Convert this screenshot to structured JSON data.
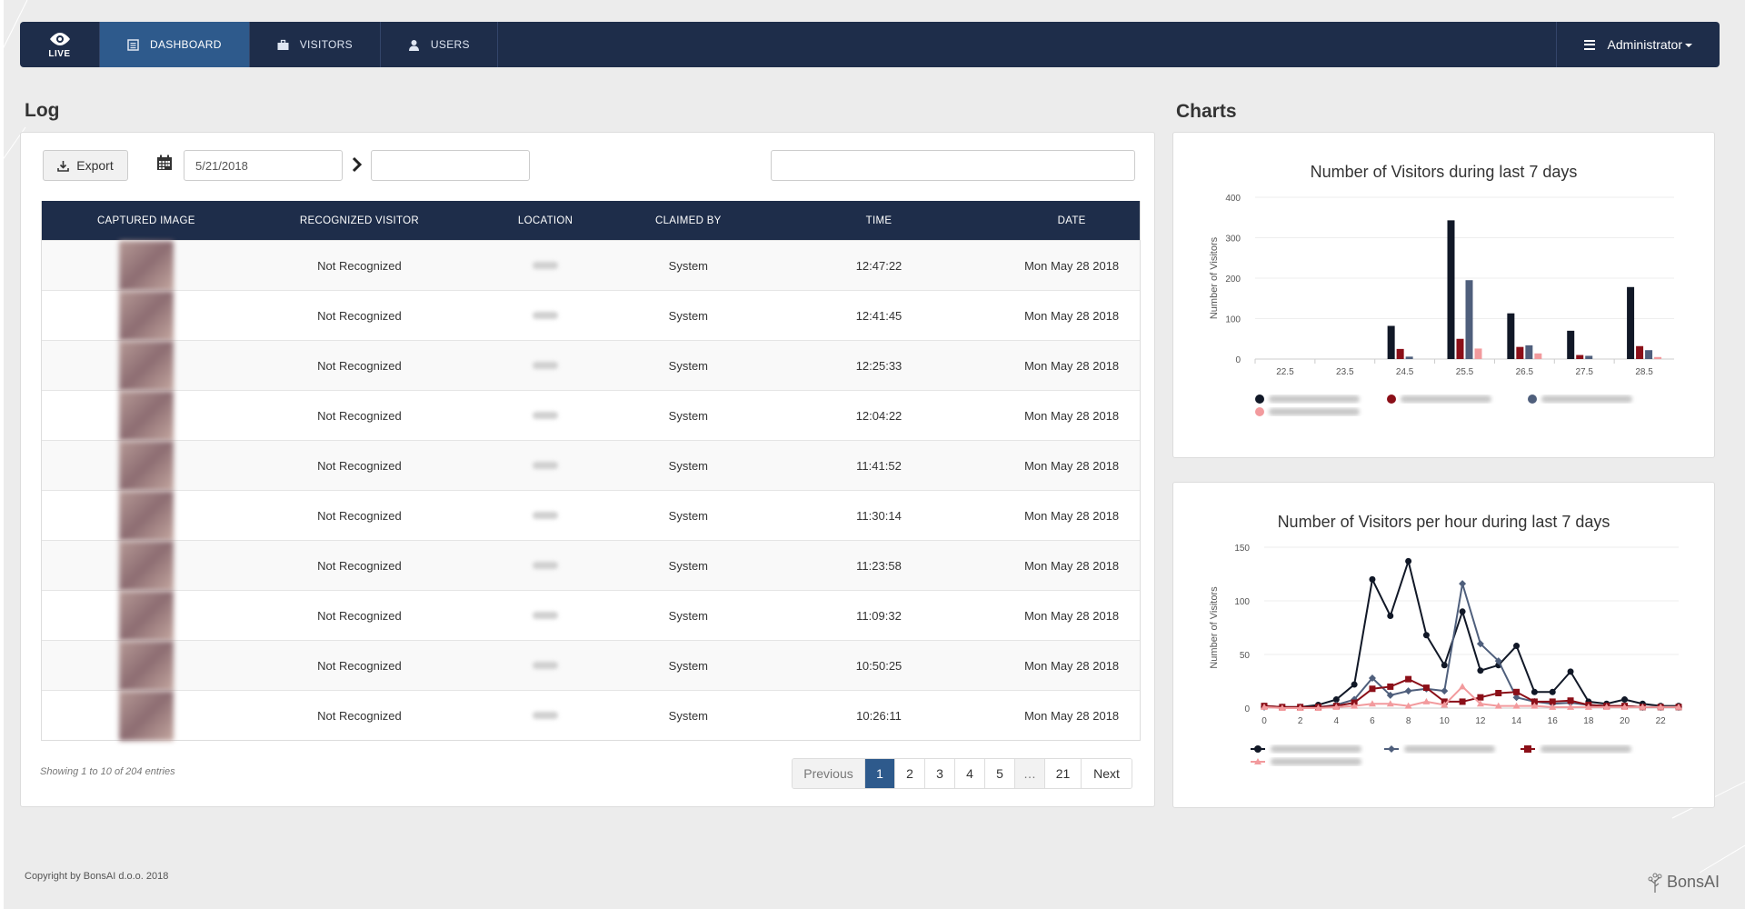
{
  "nav": {
    "brand": "LIVE",
    "items": [
      {
        "label": "DASHBOARD",
        "icon": "document-icon",
        "active": true
      },
      {
        "label": "VISITORS",
        "icon": "briefcase-icon",
        "active": false
      },
      {
        "label": "USERS",
        "icon": "user-icon",
        "active": false
      }
    ],
    "user": "Administrator"
  },
  "log": {
    "title": "Log",
    "export_label": "Export",
    "date_from": "5/21/2018",
    "date_to": "",
    "search": "",
    "columns": [
      "CAPTURED IMAGE",
      "RECOGNIZED VISITOR",
      "LOCATION",
      "CLAIMED BY",
      "TIME",
      "DATE"
    ],
    "rows": [
      {
        "visitor": "Not Recognized",
        "claimed": "System",
        "time": "12:47:22",
        "date": "Mon May 28 2018"
      },
      {
        "visitor": "Not Recognized",
        "claimed": "System",
        "time": "12:41:45",
        "date": "Mon May 28 2018"
      },
      {
        "visitor": "Not Recognized",
        "claimed": "System",
        "time": "12:25:33",
        "date": "Mon May 28 2018"
      },
      {
        "visitor": "Not Recognized",
        "claimed": "System",
        "time": "12:04:22",
        "date": "Mon May 28 2018"
      },
      {
        "visitor": "Not Recognized",
        "claimed": "System",
        "time": "11:41:52",
        "date": "Mon May 28 2018"
      },
      {
        "visitor": "Not Recognized",
        "claimed": "System",
        "time": "11:30:14",
        "date": "Mon May 28 2018"
      },
      {
        "visitor": "Not Recognized",
        "claimed": "System",
        "time": "11:23:58",
        "date": "Mon May 28 2018"
      },
      {
        "visitor": "Not Recognized",
        "claimed": "System",
        "time": "11:09:32",
        "date": "Mon May 28 2018"
      },
      {
        "visitor": "Not Recognized",
        "claimed": "System",
        "time": "10:50:25",
        "date": "Mon May 28 2018"
      },
      {
        "visitor": "Not Recognized",
        "claimed": "System",
        "time": "10:26:11",
        "date": "Mon May 28 2018"
      }
    ],
    "info": "Showing 1 to 10 of 204 entries",
    "pagination": {
      "previous": "Previous",
      "pages": [
        "1",
        "2",
        "3",
        "4",
        "5",
        "…",
        "21"
      ],
      "next": "Next"
    }
  },
  "charts_title": "Charts",
  "chart_data": [
    {
      "type": "bar",
      "title": "Number of Visitors during last 7 days",
      "ylabel": "Number of Visitors",
      "xlabel": "",
      "ylim": [
        0,
        400
      ],
      "yticks": [
        0,
        100,
        200,
        300,
        400
      ],
      "categories": [
        "22.5",
        "23.5",
        "24.5",
        "25.5",
        "26.5",
        "27.5",
        "28.5"
      ],
      "series": [
        {
          "color": "#111827",
          "values": [
            0,
            0,
            82,
            343,
            113,
            70,
            178
          ]
        },
        {
          "color": "#8b0f18",
          "values": [
            0,
            0,
            25,
            50,
            30,
            10,
            32
          ]
        },
        {
          "color": "#4f5f7c",
          "values": [
            0,
            0,
            6,
            195,
            34,
            8,
            22
          ]
        },
        {
          "color": "#f29a9d",
          "values": [
            0,
            0,
            0,
            26,
            14,
            0,
            5
          ]
        }
      ],
      "legend": "bottom"
    },
    {
      "type": "line",
      "title": "Number of Visitors per hour during last 7 days",
      "ylabel": "Number of Visitors",
      "xlabel": "",
      "ylim": [
        0,
        150
      ],
      "yticks": [
        0,
        50,
        100,
        150
      ],
      "xlim": [
        0,
        23
      ],
      "xticks": [
        0,
        2,
        4,
        6,
        8,
        10,
        12,
        14,
        16,
        18,
        20,
        22
      ],
      "x": [
        0,
        1,
        2,
        3,
        4,
        5,
        6,
        7,
        8,
        9,
        10,
        11,
        12,
        13,
        14,
        15,
        16,
        17,
        18,
        19,
        20,
        21,
        22,
        23
      ],
      "series": [
        {
          "color": "#111827",
          "marker": "circle",
          "values": [
            2,
            1,
            1,
            3,
            8,
            22,
            120,
            86,
            137,
            68,
            40,
            90,
            35,
            40,
            58,
            15,
            15,
            34,
            6,
            4,
            8,
            4,
            2,
            2
          ]
        },
        {
          "color": "#4f5f7c",
          "marker": "diamond",
          "values": [
            1,
            1,
            1,
            1,
            3,
            8,
            28,
            12,
            16,
            18,
            16,
            116,
            60,
            44,
            10,
            6,
            4,
            5,
            3,
            2,
            2,
            1,
            1,
            1
          ]
        },
        {
          "color": "#8b0f18",
          "marker": "square",
          "values": [
            2,
            1,
            1,
            1,
            2,
            5,
            18,
            20,
            27,
            19,
            6,
            6,
            10,
            14,
            15,
            6,
            6,
            7,
            3,
            2,
            2,
            1,
            1,
            1
          ]
        },
        {
          "color": "#f29a9d",
          "marker": "triangle",
          "values": [
            1,
            0,
            0,
            0,
            1,
            2,
            4,
            4,
            2,
            6,
            3,
            20,
            4,
            2,
            2,
            2,
            1,
            1,
            1,
            1,
            1,
            1,
            1,
            1
          ]
        }
      ],
      "legend": "bottom"
    }
  ],
  "footer": {
    "copyright": "Copyright by BonsAI d.o.o. 2018",
    "logo": "BonsAI"
  }
}
